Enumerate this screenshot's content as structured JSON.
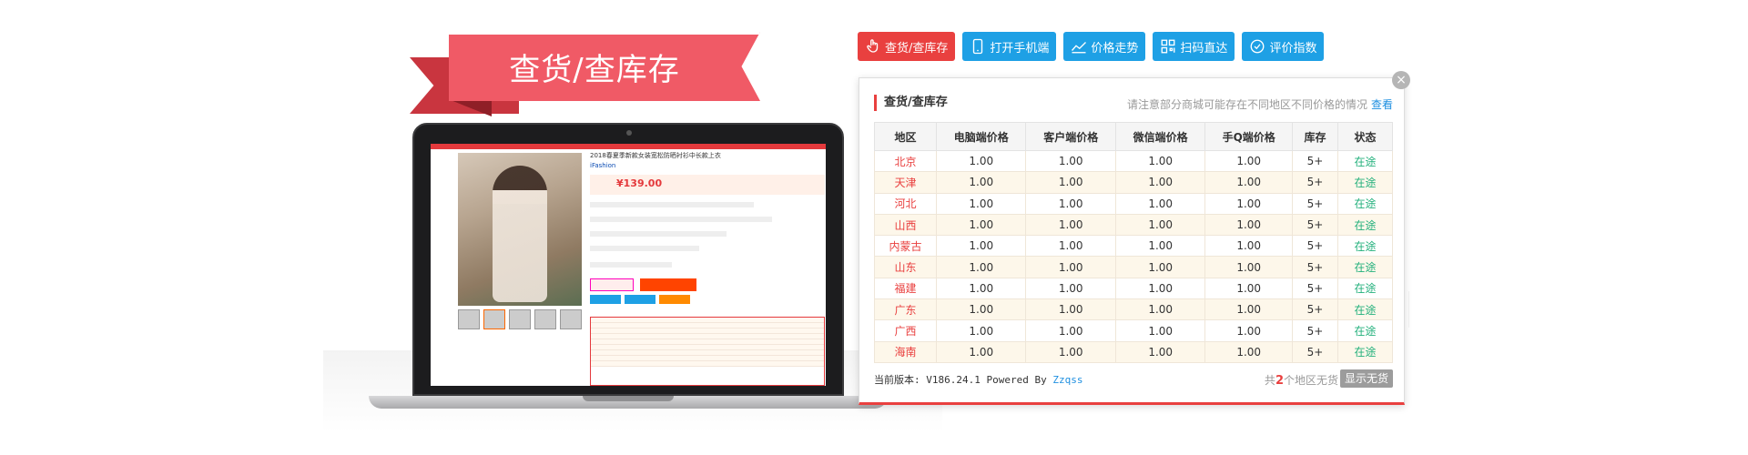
{
  "banner": {
    "title": "查货/查库存"
  },
  "laptop_screen": {
    "price": "¥139.00",
    "brand": "iFashion",
    "title_text": "2018春夏季新款女装宽松防晒衬衫中长款上衣"
  },
  "toolbar": {
    "buttons": [
      {
        "label": "查货/查库存",
        "icon": "hand-pointer-icon",
        "active": true
      },
      {
        "label": "打开手机端",
        "icon": "mobile-icon",
        "active": false
      },
      {
        "label": "价格走势",
        "icon": "trend-chart-icon",
        "active": false
      },
      {
        "label": "扫码直达",
        "icon": "qrcode-icon",
        "active": false
      },
      {
        "label": "评价指数",
        "icon": "check-circle-icon",
        "active": false
      }
    ]
  },
  "panel": {
    "title": "查货/查库存",
    "notice": "请注意部分商城可能存在不同地区不同价格的情况",
    "notice_link": "查看",
    "close": "×",
    "columns": [
      "地区",
      "电脑端价格",
      "客户端价格",
      "微信端价格",
      "手Q端价格",
      "库存",
      "状态"
    ],
    "rows": [
      [
        "北京",
        "1.00",
        "1.00",
        "1.00",
        "1.00",
        "5+",
        "在途"
      ],
      [
        "天津",
        "1.00",
        "1.00",
        "1.00",
        "1.00",
        "5+",
        "在途"
      ],
      [
        "河北",
        "1.00",
        "1.00",
        "1.00",
        "1.00",
        "5+",
        "在途"
      ],
      [
        "山西",
        "1.00",
        "1.00",
        "1.00",
        "1.00",
        "5+",
        "在途"
      ],
      [
        "内蒙古",
        "1.00",
        "1.00",
        "1.00",
        "1.00",
        "5+",
        "在途"
      ],
      [
        "山东",
        "1.00",
        "1.00",
        "1.00",
        "1.00",
        "5+",
        "在途"
      ],
      [
        "福建",
        "1.00",
        "1.00",
        "1.00",
        "1.00",
        "5+",
        "在途"
      ],
      [
        "广东",
        "1.00",
        "1.00",
        "1.00",
        "1.00",
        "5+",
        "在途"
      ],
      [
        "广西",
        "1.00",
        "1.00",
        "1.00",
        "1.00",
        "5+",
        "在途"
      ],
      [
        "海南",
        "1.00",
        "1.00",
        "1.00",
        "1.00",
        "5+",
        "在途"
      ]
    ],
    "version_prefix": "当前版本: V186.24.1 Powered  By",
    "version_link": "Zzqss",
    "count_prefix": "共",
    "count_value": "2",
    "count_suffix": "个地区无货",
    "show_button": "显示无货"
  },
  "colors": {
    "accent_red": "#e9403f",
    "accent_blue": "#1ea0e5",
    "status_green": "#22b07b",
    "ribbon": "#f05a66"
  }
}
